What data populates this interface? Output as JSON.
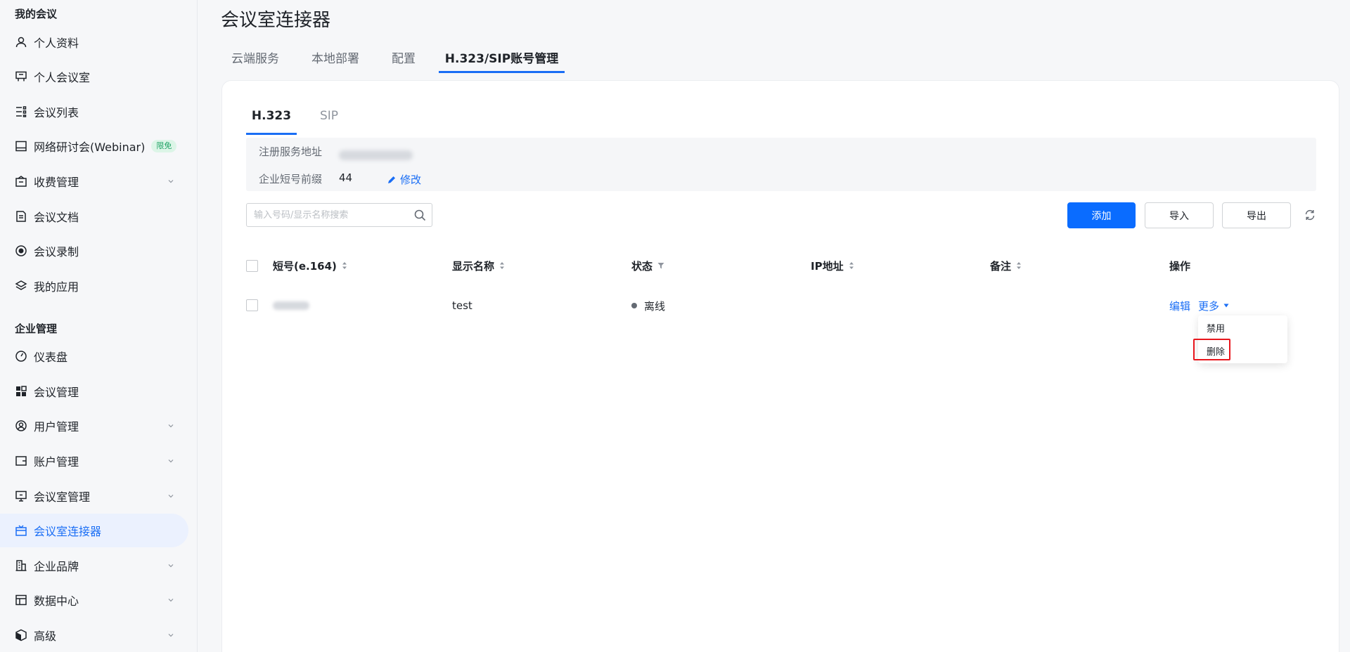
{
  "sidebar": {
    "section_my": "我的会议",
    "section_enterprise": "企业管理",
    "items": [
      {
        "label": "个人资料",
        "icon": "user-icon"
      },
      {
        "label": "个人会议室",
        "icon": "meeting-room-icon"
      },
      {
        "label": "会议列表",
        "icon": "list-icon"
      },
      {
        "label": "网络研讨会(Webinar)",
        "icon": "webinar-icon",
        "badge": "限免"
      },
      {
        "label": "收费管理",
        "icon": "billing-icon"
      },
      {
        "label": "会议文档",
        "icon": "document-icon"
      },
      {
        "label": "会议录制",
        "icon": "record-icon"
      },
      {
        "label": "我的应用",
        "icon": "apps-layers-icon"
      },
      {
        "label": "仪表盘",
        "icon": "dashboard-icon"
      },
      {
        "label": "会议管理",
        "icon": "grid-icon"
      },
      {
        "label": "用户管理",
        "icon": "user-manage-icon"
      },
      {
        "label": "账户管理",
        "icon": "wallet-icon"
      },
      {
        "label": "会议室管理",
        "icon": "room-manage-icon"
      },
      {
        "label": "会议室连接器",
        "icon": "connector-icon"
      },
      {
        "label": "企业品牌",
        "icon": "building-icon"
      },
      {
        "label": "数据中心",
        "icon": "data-center-icon"
      },
      {
        "label": "高级",
        "icon": "advanced-cube-icon"
      }
    ]
  },
  "header": {
    "title": "会议室连接器",
    "tabs": [
      "云端服务",
      "本地部署",
      "配置",
      "H.323/SIP账号管理"
    ]
  },
  "subtabs": [
    "H.323",
    "SIP"
  ],
  "info": {
    "register_label": "注册服务地址",
    "prefix_label": "企业短号前缀",
    "prefix_value": "44",
    "edit_label": "修改"
  },
  "toolbar": {
    "search_placeholder": "输入号码/显示名称搜索",
    "add": "添加",
    "import": "导入",
    "export": "导出"
  },
  "table": {
    "columns": [
      "短号(e.164)",
      "显示名称",
      "状态",
      "IP地址",
      "备注",
      "操作"
    ],
    "rows": [
      {
        "name": "test",
        "status": "离线",
        "edit": "编辑",
        "more": "更多"
      }
    ]
  },
  "dropdown": {
    "items": [
      "禁用",
      "删除"
    ]
  },
  "colors": {
    "accent": "#1a6ef5",
    "primary_button": "#0a6cff",
    "highlight_border": "#e8161d"
  }
}
